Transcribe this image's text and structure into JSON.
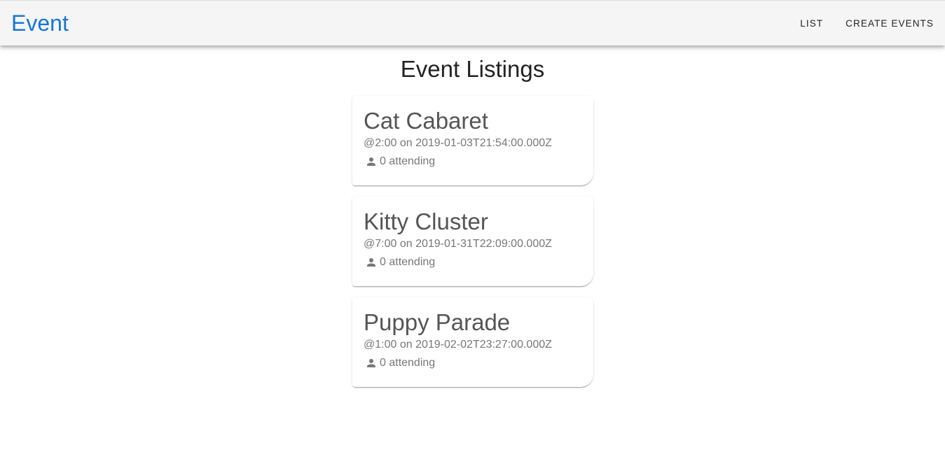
{
  "appbar": {
    "title": "Event",
    "nav": [
      {
        "label": "List"
      },
      {
        "label": "Create Events"
      }
    ]
  },
  "page_title": "Event Listings",
  "colors": {
    "brand": "#1976d2",
    "appbar_bg": "#f5f5f5"
  },
  "events": [
    {
      "name": "Cat Cabaret",
      "when": "@2:00 on 2019-01-03T21:54:00.000Z",
      "attending": "0 attending",
      "icon": "person-icon"
    },
    {
      "name": "Kitty Cluster",
      "when": "@7:00 on 2019-01-31T22:09:00.000Z",
      "attending": "0 attending",
      "icon": "person-icon"
    },
    {
      "name": "Puppy Parade",
      "when": "@1:00 on 2019-02-02T23:27:00.000Z",
      "attending": "0 attending",
      "icon": "person-icon"
    }
  ]
}
